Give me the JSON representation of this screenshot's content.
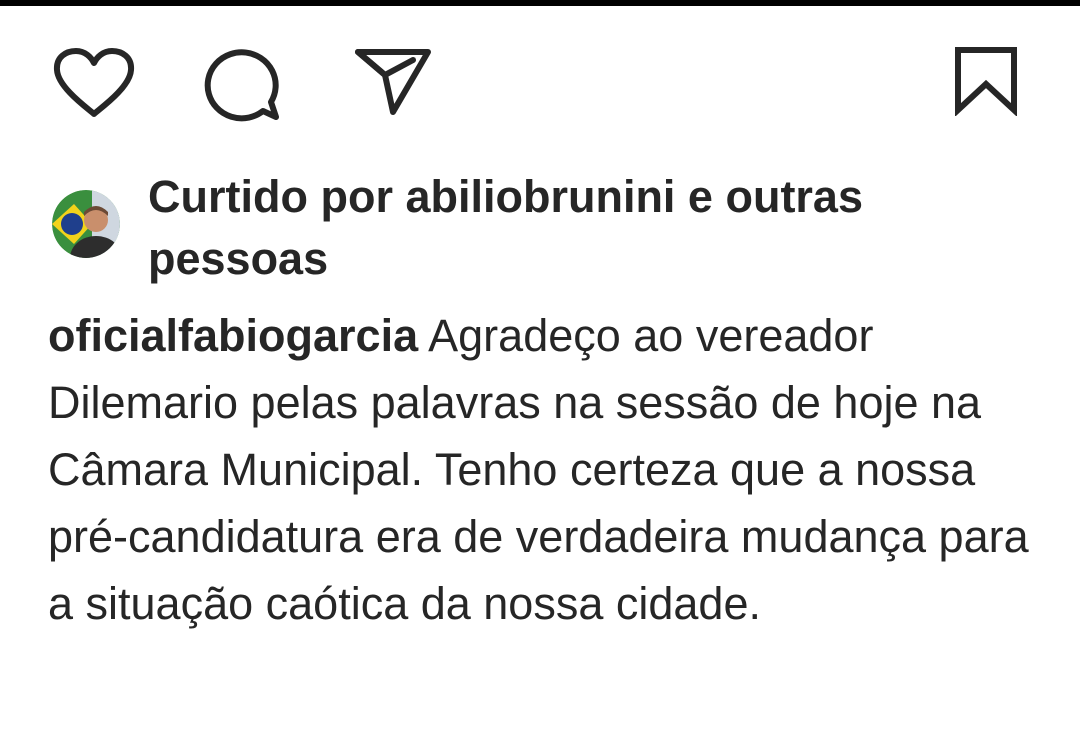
{
  "actions": {
    "like_icon": "heart-outline",
    "comment_icon": "speech-bubble-outline",
    "share_icon": "paper-plane-outline",
    "save_icon": "bookmark-outline"
  },
  "likes": {
    "text": "Curtido por abiliobrunini e outras pessoas"
  },
  "caption": {
    "username": "oficialfabiogarcia",
    "text": "Agradeço ao vereador Dilemario pelas palavras na sessão de hoje na Câmara Municipal.  Tenho certeza que a nossa pré-candidatura era de verdadeira mudança para a situação caótica da nossa cidade."
  },
  "colors": {
    "text": "#262626",
    "background": "#ffffff",
    "top_border": "#000000"
  }
}
